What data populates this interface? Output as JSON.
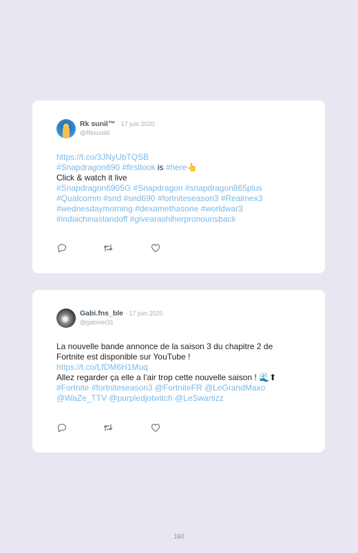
{
  "tweets": [
    {
      "name": "Rk sunil™",
      "date": "· 17 juin 2020",
      "handle": "@Rksunil6",
      "lines": [
        [
          {
            "t": "https://t.co/3JNyUbTQSB",
            "link": true
          }
        ],
        [
          {
            "t": "#Snapdragon690 #firstlook",
            "link": true
          },
          {
            "t": " is ",
            "link": false
          },
          {
            "t": "#here",
            "link": true
          },
          {
            "t": "👆",
            "link": false
          }
        ],
        [
          {
            "t": "Click & watch it live",
            "link": false
          }
        ],
        [
          {
            "t": "#Snapdragon6905G #Snapdragon #snapdragon865plus",
            "link": true
          }
        ],
        [
          {
            "t": "#Qualcomm #snd #snd690 #fortniteseason3 #Realmex3",
            "link": true
          }
        ],
        [
          {
            "t": "#wednesdaymorning #dexamethasone #worldwar3",
            "link": true
          }
        ],
        [
          {
            "t": "#indiachinastandoff #givearashiherpronounsback",
            "link": true
          }
        ]
      ]
    },
    {
      "name": "Gabi.fns_ble",
      "date": "· 17 juin 2020",
      "handle": "@gabiner31",
      "lines": [
        [
          {
            "t": "La nouvelle bande annonce de la saison 3 du chapitre 2 de",
            "link": false
          }
        ],
        [
          {
            "t": "Fortnite est disponible sur YouTube !",
            "link": false
          }
        ],
        [
          {
            "t": "https://t.co/LfDM6H1Muq",
            "link": true
          }
        ],
        [
          {
            "t": "Allez regarder ça elle a l’air trop cette nouvelle saison ! ",
            "link": false
          },
          {
            "t": "🌊⬆",
            "link": false
          }
        ],
        [
          {
            "t": "#Fortnite #fortniteseason3 @FortniteFR @LeGrandMaxo",
            "link": true
          }
        ],
        [
          {
            "t": "@WaZe_TTV @purpledjotwitch @LeSwartizz",
            "link": true
          }
        ]
      ]
    }
  ],
  "footer": {
    "page_number": "160"
  }
}
